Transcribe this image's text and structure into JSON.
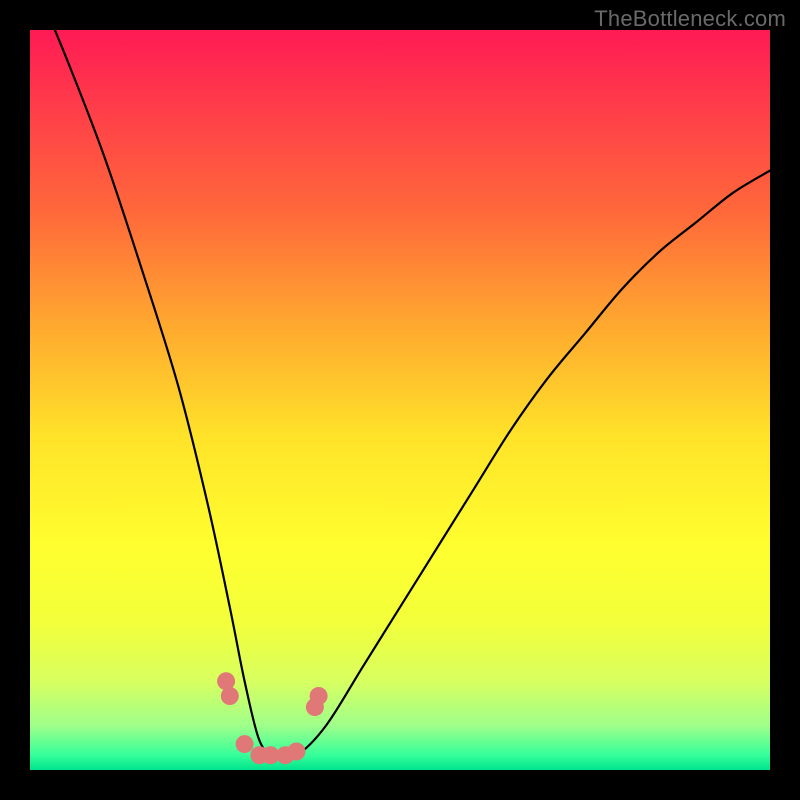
{
  "watermark": "TheBottleneck.com",
  "chart_data": {
    "type": "line",
    "title": "",
    "xlabel": "",
    "ylabel": "",
    "xlim": [
      0,
      100
    ],
    "ylim": [
      0,
      100
    ],
    "series": [
      {
        "name": "bottleneck-curve",
        "x": [
          0,
          5,
          10,
          15,
          20,
          24,
          27,
          29,
          31,
          33,
          36,
          40,
          45,
          50,
          55,
          60,
          65,
          70,
          75,
          80,
          85,
          90,
          95,
          100
        ],
        "values": [
          108,
          96,
          83,
          68,
          52,
          36,
          22,
          12,
          4,
          2,
          2,
          6,
          14,
          22,
          30,
          38,
          46,
          53,
          59,
          65,
          70,
          74,
          78,
          81
        ]
      }
    ],
    "markers": {
      "name": "highlight-dots",
      "color": "#e07878",
      "x": [
        26.5,
        27.0,
        29.0,
        31.0,
        32.5,
        34.5,
        36.0,
        38.5,
        39.0
      ],
      "values": [
        12.0,
        10.0,
        3.5,
        2.0,
        2.0,
        2.0,
        2.5,
        8.5,
        10.0
      ]
    },
    "gradient_stops": [
      {
        "pos": 0,
        "color": "#ff1a54"
      },
      {
        "pos": 25,
        "color": "#ff6a3a"
      },
      {
        "pos": 55,
        "color": "#ffe329"
      },
      {
        "pos": 80,
        "color": "#f2ff3a"
      },
      {
        "pos": 100,
        "color": "#00e38c"
      }
    ]
  }
}
